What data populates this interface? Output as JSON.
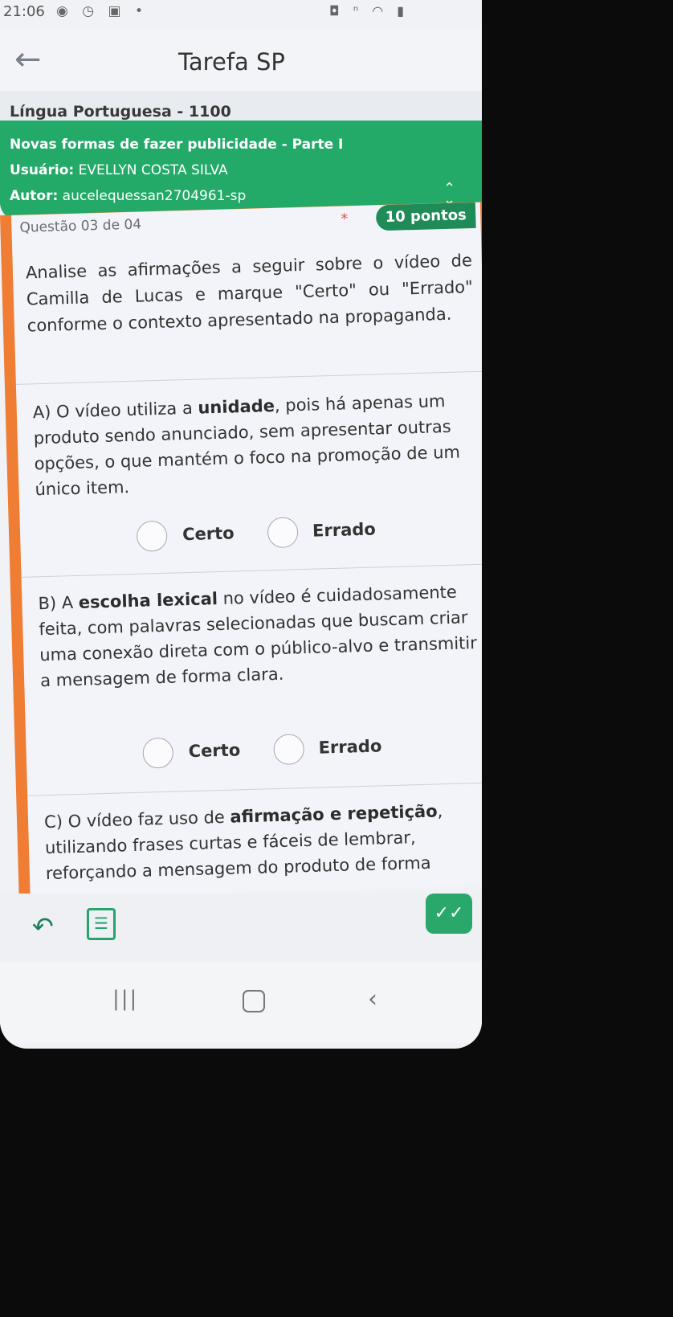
{
  "status_bar": {
    "time": "21:06",
    "left_icons": "◉ ◷ ▣ •",
    "right_icons": "◘ ⁿ ◠ ▮"
  },
  "app_bar": {
    "title": "Tarefa SP"
  },
  "subject": "Língua Portuguesa - 1100",
  "task": {
    "title": "Novas formas de fazer publicidade - Parte I",
    "user_label": "Usuário:",
    "user_name": "EVELLYN COSTA SILVA",
    "author_label": "Autor:",
    "author_name": "aucelequessan2704961-sp"
  },
  "question": {
    "number": "Questão 03 de 04",
    "required_mark": "*",
    "points": "10 pontos",
    "prompt": "Analise as afirmações a seguir sobre o vídeo de Camilla de Lucas e marque \"Certo\" ou \"Errado\" conforme o contexto apresentado na propaganda.",
    "statements": [
      {
        "prefix": "A) O vídeo utiliza a ",
        "bold": "unidade",
        "suffix": ", pois há apenas um produto sendo anunciado, sem apresentar outras opções, o que mantém o foco na promoção de um único item.",
        "option_certo": "Certo",
        "option_errado": "Errado"
      },
      {
        "prefix": "B) A ",
        "bold": "escolha lexical",
        "suffix": " no vídeo é cuidadosamente feita, com palavras selecionadas que buscam criar uma conexão direta com o público-alvo e transmitir a mensagem de forma clara.",
        "option_certo": "Certo",
        "option_errado": "Errado"
      },
      {
        "prefix": "C) O vídeo faz uso de ",
        "bold": "afirmação e repetição",
        "suffix": ", utilizando frases curtas e fáceis de lembrar, reforçando a mensagem do produto de forma"
      }
    ]
  },
  "colors": {
    "green": "#23a968",
    "orange": "#ef7d34",
    "points_badge": "#1f8c57"
  },
  "icons": {
    "back": "left-arrow-icon",
    "collapse": "chevron-up-down-icon",
    "toolbar_back": "return-arrow-icon",
    "toolbar_edit": "edit-note-icon",
    "toolbar_confirm": "check-double-icon"
  }
}
